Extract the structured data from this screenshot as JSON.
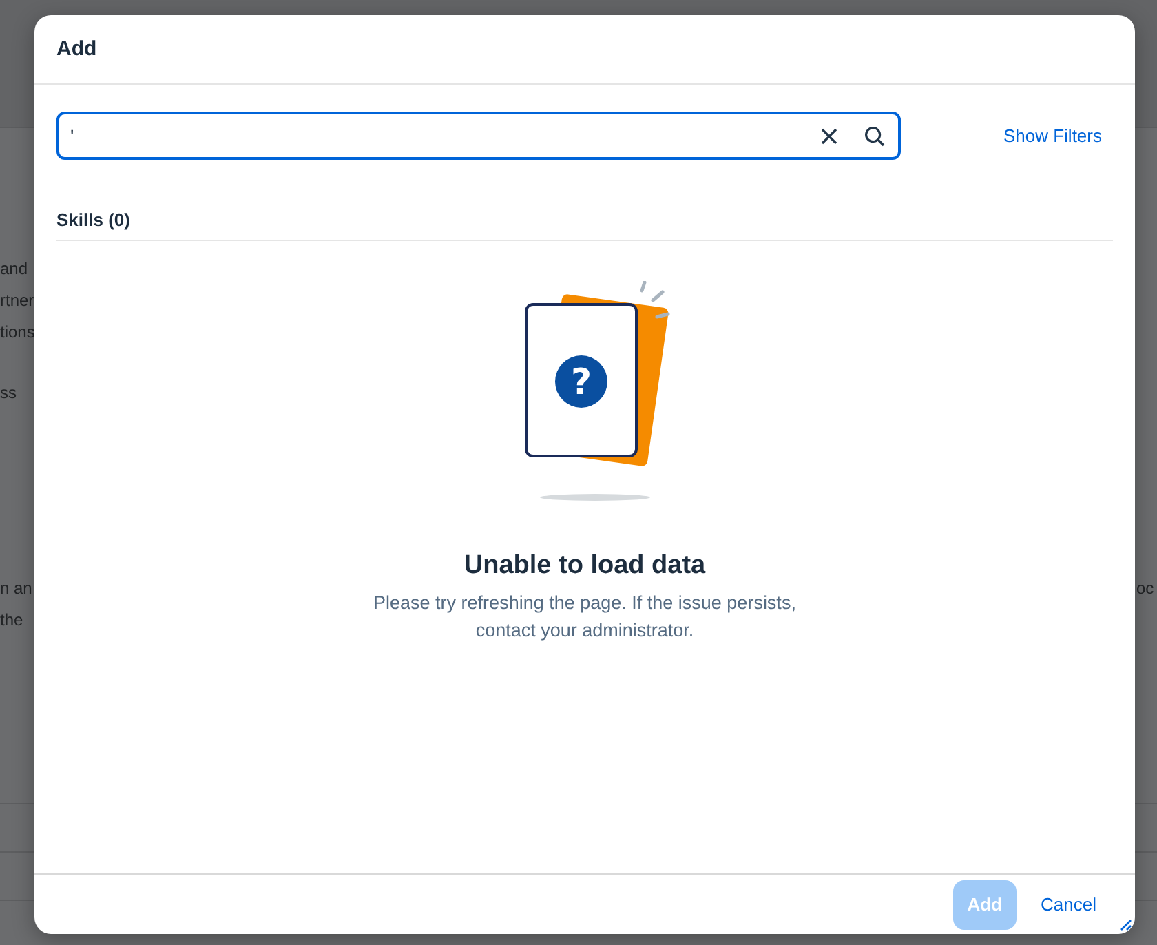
{
  "background_page": {
    "left_fragments": [
      "and",
      "rtner",
      "tions",
      "ss",
      "n an",
      "the"
    ],
    "right_fragments": [
      "oc"
    ]
  },
  "dialog": {
    "title": "Add",
    "search": {
      "value": "'"
    },
    "show_filters": "Show Filters",
    "section_title": "Skills (0)",
    "illustration_glyph": "?",
    "empty_state": {
      "title": "Unable to load data",
      "description": "Please try refreshing the page. If the issue persists, contact your administrator."
    },
    "buttons": [
      {
        "label": "Add",
        "kind": "emphasized",
        "disabled": true
      },
      {
        "label": "Cancel",
        "kind": "transparent",
        "disabled": false
      }
    ]
  }
}
